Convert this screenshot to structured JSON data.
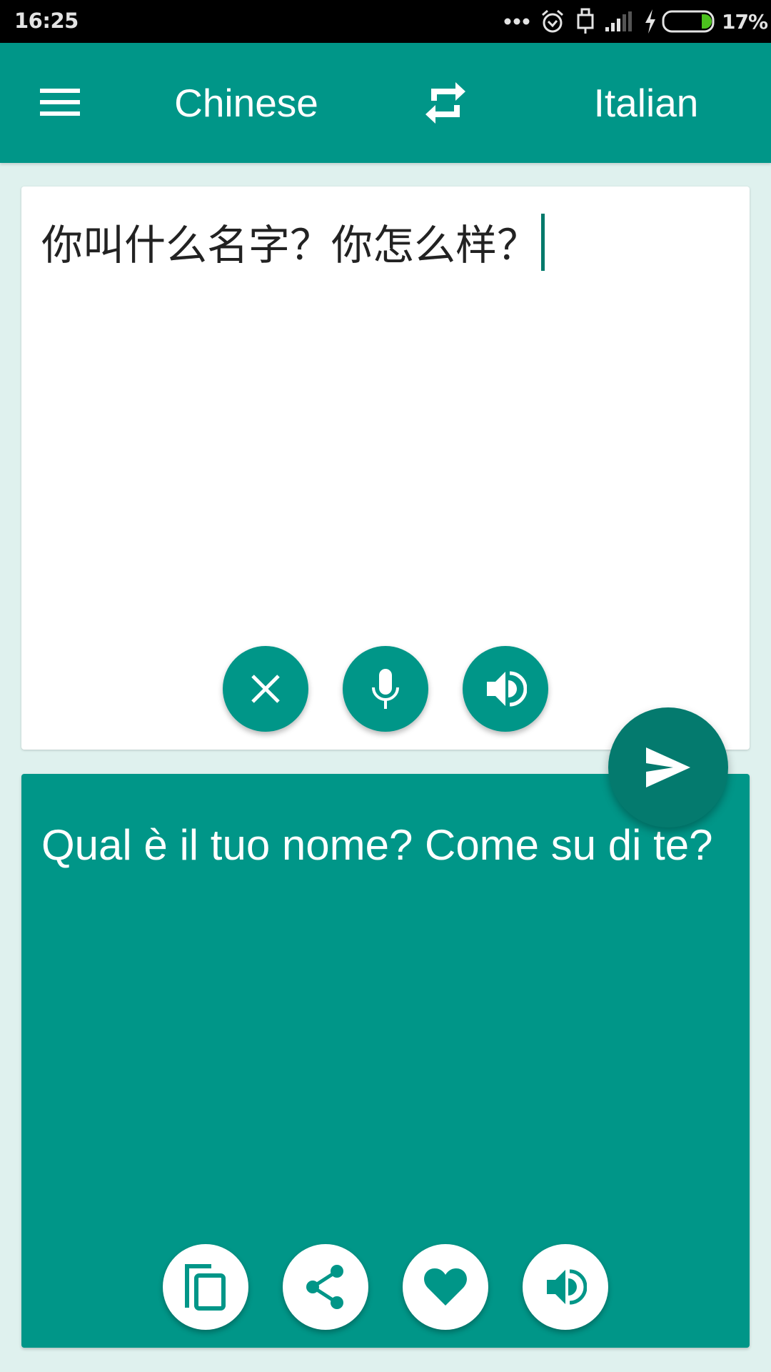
{
  "status_bar": {
    "time": "16:25",
    "icons": [
      "more-notifications-icon",
      "alarm-icon",
      "usb-icon",
      "signal-icon",
      "charging-icon",
      "battery-icon"
    ],
    "battery_percent": "17%",
    "battery_level": 0.17
  },
  "app_bar": {
    "menu_icon": "hamburger-menu-icon",
    "source_language": "Chinese",
    "swap_icon": "swap-languages-icon",
    "target_language": "Italian"
  },
  "input_card": {
    "text": "你叫什么名字？你怎么样？",
    "actions": [
      {
        "name": "clear",
        "icon": "close-icon"
      },
      {
        "name": "voice-input",
        "icon": "microphone-icon"
      },
      {
        "name": "speak-source",
        "icon": "speaker-icon"
      }
    ]
  },
  "translate_button": {
    "icon": "send-icon"
  },
  "output_card": {
    "text": "Qual è il tuo nome? Come su di te?",
    "actions": [
      {
        "name": "copy",
        "icon": "copy-icon"
      },
      {
        "name": "share",
        "icon": "share-icon"
      },
      {
        "name": "favorite",
        "icon": "heart-icon"
      },
      {
        "name": "speak-translation",
        "icon": "speaker-icon"
      }
    ]
  },
  "colors": {
    "primary": "#009688",
    "primary_dark": "#047a6e",
    "background": "#dff1ee",
    "battery_fill": "#4cc21e"
  }
}
